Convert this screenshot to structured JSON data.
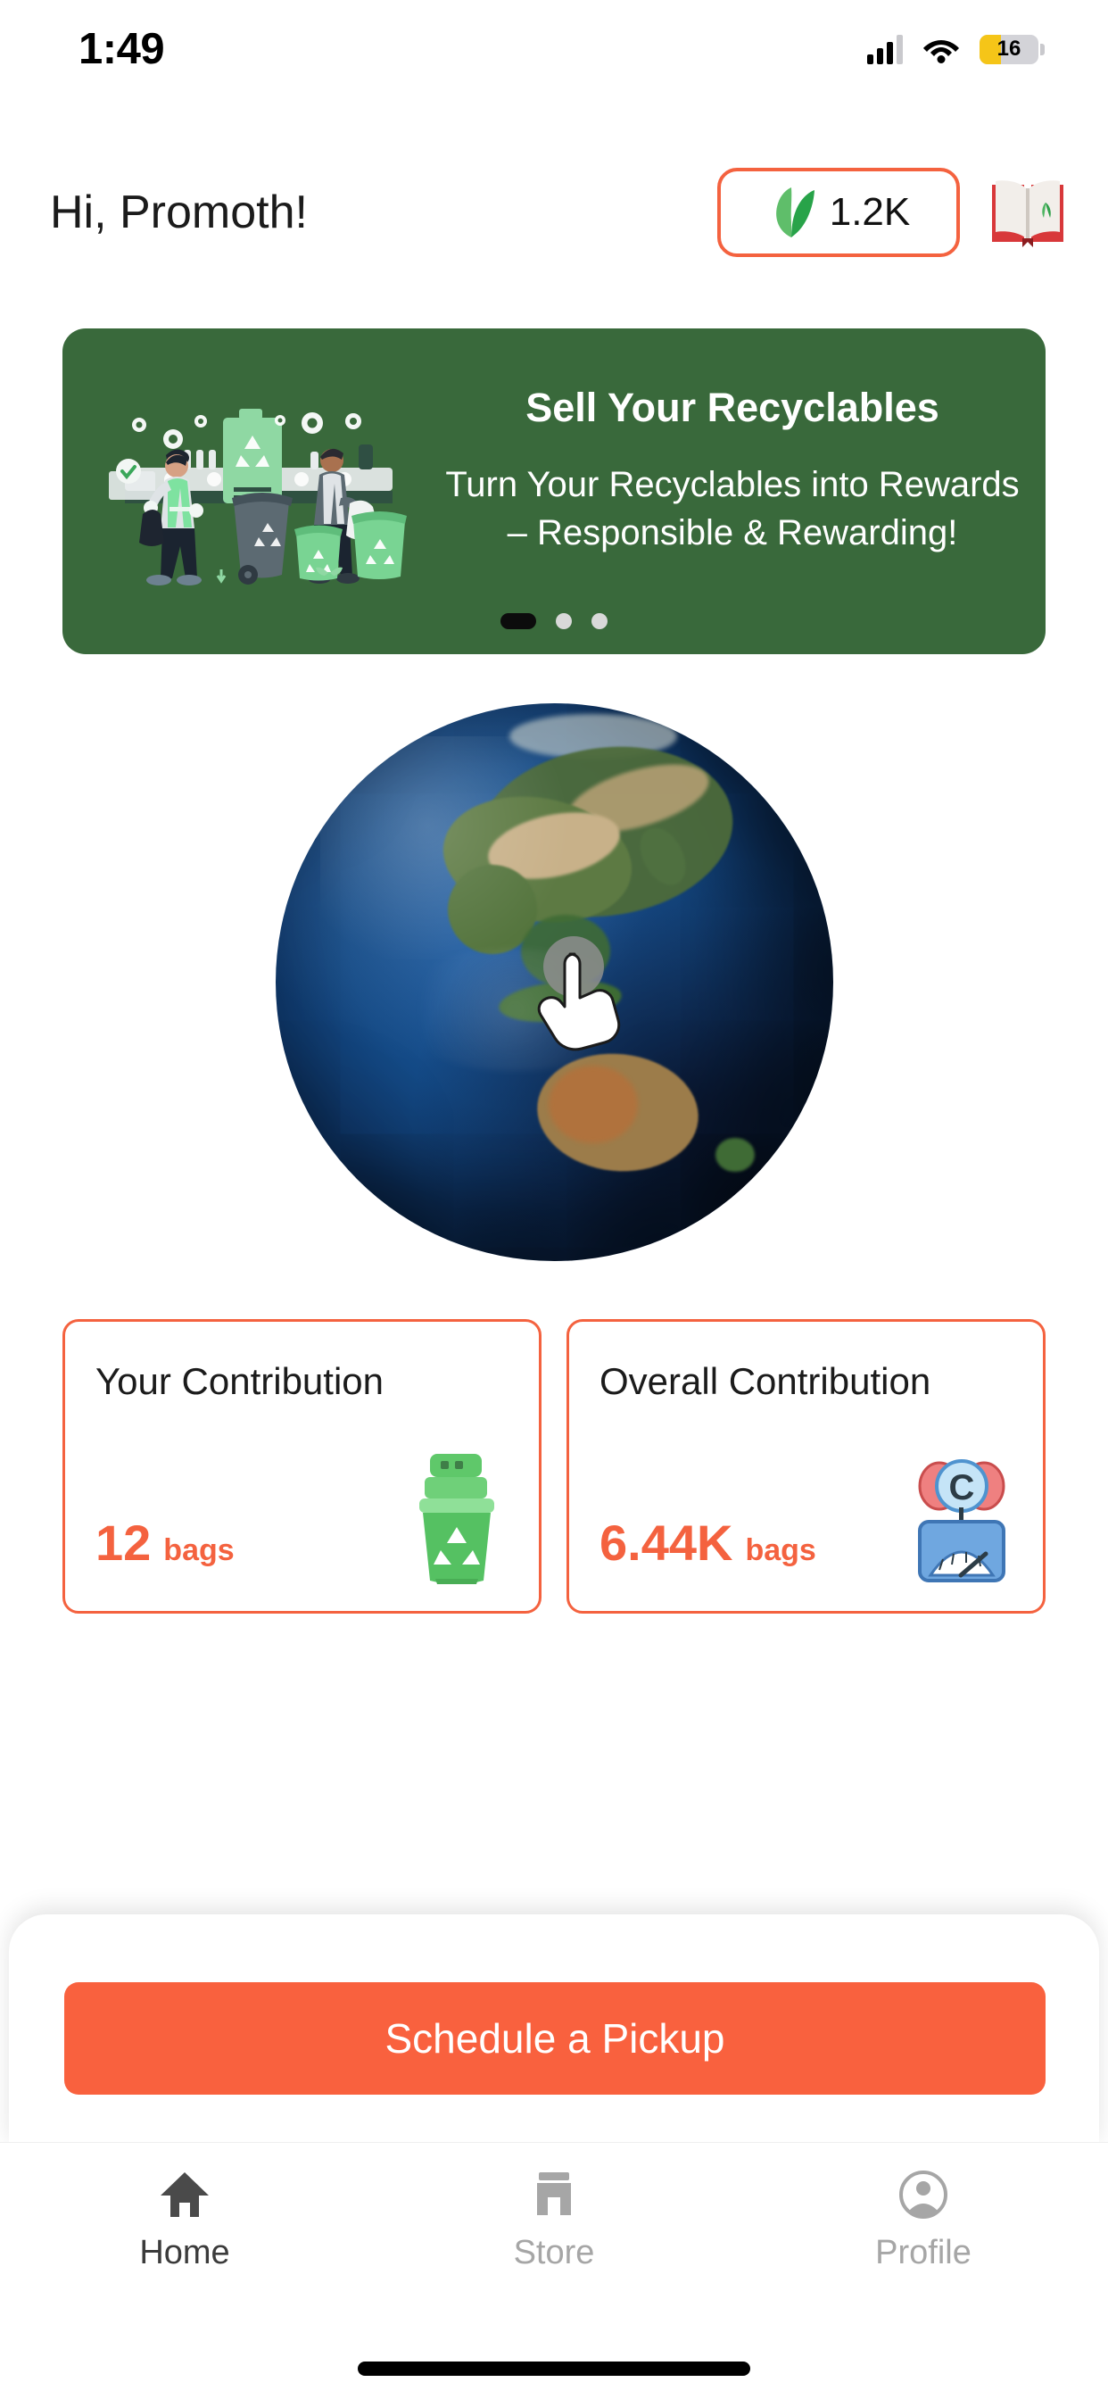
{
  "status_bar": {
    "time": "1:49",
    "signal_icon": "cellular-signal-icon",
    "wifi_icon": "wifi-icon",
    "battery_level": "16",
    "battery_icon": "battery-low-icon"
  },
  "header": {
    "greeting": "Hi, Promoth!",
    "points": {
      "value": "1.2K",
      "icon": "leaf-icon"
    },
    "book_button_icon": "open-book-icon"
  },
  "banner": {
    "title": "Sell Your Recyclables",
    "subtitle": "Turn Your Recyclables into Rewards – Responsible & Rewarding!",
    "illustration": "recycling-workers-illustration",
    "background_color": "#39693b",
    "carousel": {
      "total": 3,
      "active_index": 0
    }
  },
  "globe": {
    "icon": "earth-globe-icon",
    "cursor_icon": "tap-hand-cursor-icon"
  },
  "stats": [
    {
      "title": "Your Contribution",
      "value": "12",
      "unit": "bags",
      "icon": "recycling-bin-icon"
    },
    {
      "title": "Overall Contribution",
      "value": "6.44K",
      "unit": "bags",
      "icon": "weighing-scale-icon"
    }
  ],
  "cta": {
    "label": "Schedule a Pickup",
    "color": "#f9613e"
  },
  "tabbar": {
    "items": [
      {
        "label": "Home",
        "icon": "home-icon",
        "active": true
      },
      {
        "label": "Store",
        "icon": "store-icon",
        "active": false
      },
      {
        "label": "Profile",
        "icon": "profile-icon",
        "active": false
      }
    ]
  },
  "colors": {
    "accent_orange": "#f4623f",
    "banner_green": "#39693b",
    "cta_orange": "#f9613e"
  }
}
